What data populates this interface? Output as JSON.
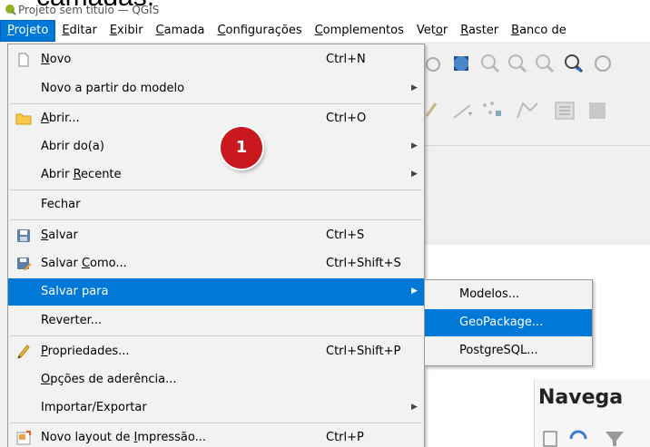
{
  "window": {
    "title": "Projeto sem título — QGIS",
    "caption_overlay": "camadas."
  },
  "menubar": [
    {
      "label": "Projeto",
      "active": true
    },
    {
      "label": "Editar"
    },
    {
      "label": "Exibir"
    },
    {
      "label": "Camada"
    },
    {
      "label": "Configurações"
    },
    {
      "label": "Complementos"
    },
    {
      "label": "Vetor"
    },
    {
      "label": "Raster"
    },
    {
      "label": "Banco de"
    }
  ],
  "project_menu": {
    "items": [
      {
        "label": "Novo",
        "shortcut": "Ctrl+N",
        "icon": "new-document-icon"
      },
      {
        "label": "Novo a partir do modelo",
        "submenu": true
      },
      {
        "label": "Abrir...",
        "shortcut": "Ctrl+O",
        "icon": "folder-open-icon"
      },
      {
        "label": "Abrir do(a)",
        "submenu": true
      },
      {
        "label": "Abrir Recente",
        "submenu": true
      },
      {
        "label": "Fechar"
      },
      {
        "label": "Salvar",
        "shortcut": "Ctrl+S",
        "icon": "save-icon"
      },
      {
        "label": "Salvar Como...",
        "shortcut": "Ctrl+Shift+S",
        "icon": "save-as-icon"
      },
      {
        "label": "Salvar para",
        "submenu": true,
        "highlighted": true
      },
      {
        "label": "Reverter..."
      },
      {
        "label": "Propriedades...",
        "shortcut": "Ctrl+Shift+P",
        "icon": "properties-pencil-icon"
      },
      {
        "label": "Opções de aderência..."
      },
      {
        "label": "Importar/Exportar",
        "submenu": true
      },
      {
        "label": "Novo layout de Impressão...",
        "shortcut": "Ctrl+P",
        "icon": "new-layout-icon"
      }
    ]
  },
  "save_to_submenu": {
    "items": [
      {
        "label": "Modelos..."
      },
      {
        "label": "GeoPackage...",
        "highlighted": true
      },
      {
        "label": "PostgreSQL..."
      }
    ]
  },
  "step_badge": "1",
  "browser_panel": {
    "title": "Navega"
  },
  "colors": {
    "highlight": "#0078d7",
    "badge": "#c9181e"
  }
}
